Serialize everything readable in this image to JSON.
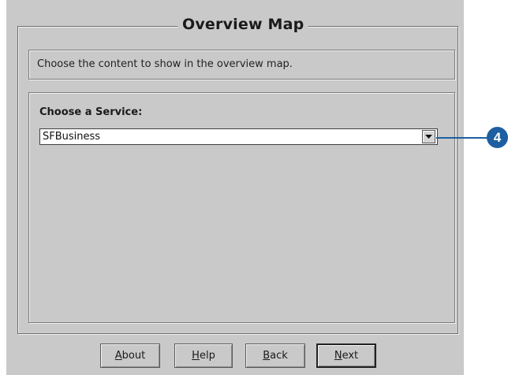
{
  "dialog": {
    "title": "Overview Map",
    "instruction": "Choose the content to show in the overview map.",
    "service_label": "Choose a Service:",
    "service_select": {
      "selected": "SFBusiness"
    }
  },
  "buttons": {
    "about": {
      "mnemonic": "A",
      "rest": "bout"
    },
    "help": {
      "mnemonic": "H",
      "rest": "elp"
    },
    "back": {
      "mnemonic": "B",
      "rest": "ack"
    },
    "next": {
      "mnemonic": "N",
      "rest": "ext"
    }
  },
  "callout": {
    "number": "4",
    "color": "#1d5fa0"
  },
  "icons": {
    "dropdown": "chevron-down-icon"
  }
}
